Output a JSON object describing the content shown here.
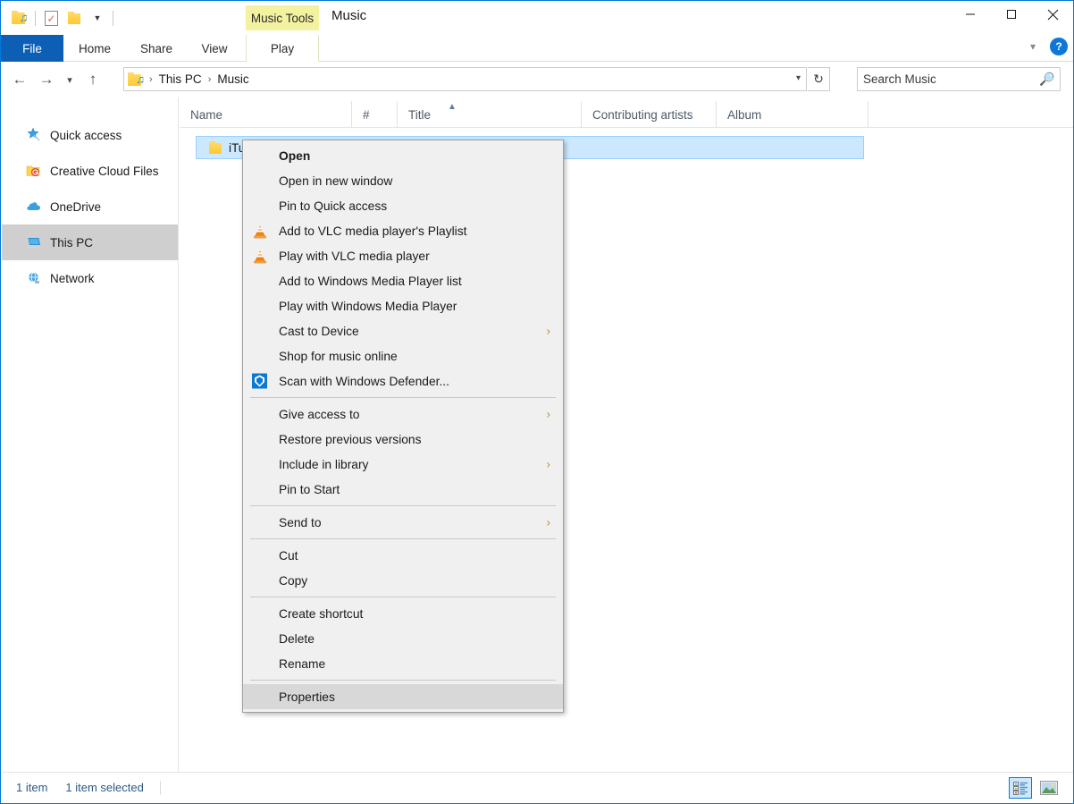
{
  "window": {
    "title": "Music",
    "contextual_tab_group": "Music Tools",
    "controls": {
      "minimize": "Minimize",
      "maximize": "Maximize",
      "close": "Close"
    }
  },
  "quick_access_toolbar": {
    "items": [
      {
        "name": "music-folder-icon",
        "label": "Music"
      },
      {
        "name": "properties-icon",
        "label": "Properties"
      },
      {
        "name": "new-folder-icon",
        "label": "New folder"
      }
    ],
    "customize_label": "Customize Quick Access Toolbar"
  },
  "ribbon": {
    "tabs": [
      {
        "label": "File",
        "active": false,
        "style": "file"
      },
      {
        "label": "Home",
        "active": false
      },
      {
        "label": "Share",
        "active": false
      },
      {
        "label": "View",
        "active": false
      },
      {
        "label": "Play",
        "active": true,
        "group": "Music Tools"
      }
    ],
    "expand_label": "Expand the Ribbon",
    "help_label": "?"
  },
  "navigation": {
    "back": "Back",
    "forward": "Forward",
    "recent": "Recent locations",
    "up": "Up",
    "breadcrumbs": [
      "This PC",
      "Music"
    ],
    "breadcrumb_separator": "›",
    "refresh": "Refresh"
  },
  "search": {
    "placeholder": "Search Music",
    "value": "",
    "icon": "search-icon"
  },
  "sidebar": {
    "items": [
      {
        "label": "Quick access",
        "icon": "star-pin-icon",
        "selected": false
      },
      {
        "label": "Creative Cloud Files",
        "icon": "creative-cloud-icon",
        "selected": false
      },
      {
        "label": "OneDrive",
        "icon": "cloud-icon",
        "selected": false
      },
      {
        "label": "This PC",
        "icon": "computer-icon",
        "selected": true
      },
      {
        "label": "Network",
        "icon": "network-icon",
        "selected": false
      }
    ]
  },
  "columns": [
    {
      "label": "Name",
      "sorted": true,
      "sort_direction": "ascending"
    },
    {
      "label": "#",
      "sorted": false
    },
    {
      "label": "Title",
      "sorted": false
    },
    {
      "label": "Contributing artists",
      "sorted": false
    },
    {
      "label": "Album",
      "sorted": false
    }
  ],
  "files": [
    {
      "name": "iTu",
      "icon": "folder-icon",
      "selected": true,
      "number": "",
      "title": "",
      "artists": "",
      "album": ""
    }
  ],
  "context_menu": {
    "groups": [
      {
        "items": [
          {
            "label": "Open",
            "bold": true,
            "icon": null,
            "submenu": false,
            "highlighted": false
          },
          {
            "label": "Open in new window",
            "bold": false,
            "icon": null,
            "submenu": false,
            "highlighted": false
          },
          {
            "label": "Pin to Quick access",
            "bold": false,
            "icon": null,
            "submenu": false,
            "highlighted": false
          },
          {
            "label": "Add to VLC media player's Playlist",
            "bold": false,
            "icon": "vlc-cone-icon",
            "submenu": false,
            "highlighted": false
          },
          {
            "label": "Play with VLC media player",
            "bold": false,
            "icon": "vlc-cone-icon",
            "submenu": false,
            "highlighted": false
          },
          {
            "label": "Add to Windows Media Player list",
            "bold": false,
            "icon": null,
            "submenu": false,
            "highlighted": false
          },
          {
            "label": "Play with Windows Media Player",
            "bold": false,
            "icon": null,
            "submenu": false,
            "highlighted": false
          },
          {
            "label": "Cast to Device",
            "bold": false,
            "icon": null,
            "submenu": true,
            "highlighted": false
          },
          {
            "label": "Shop for music online",
            "bold": false,
            "icon": null,
            "submenu": false,
            "highlighted": false
          },
          {
            "label": "Scan with Windows Defender...",
            "bold": false,
            "icon": "windows-defender-icon",
            "submenu": false,
            "highlighted": false
          }
        ]
      },
      {
        "items": [
          {
            "label": "Give access to",
            "bold": false,
            "icon": null,
            "submenu": true,
            "highlighted": false
          },
          {
            "label": "Restore previous versions",
            "bold": false,
            "icon": null,
            "submenu": false,
            "highlighted": false
          },
          {
            "label": "Include in library",
            "bold": false,
            "icon": null,
            "submenu": true,
            "highlighted": false
          },
          {
            "label": "Pin to Start",
            "bold": false,
            "icon": null,
            "submenu": false,
            "highlighted": false
          }
        ]
      },
      {
        "items": [
          {
            "label": "Send to",
            "bold": false,
            "icon": null,
            "submenu": true,
            "highlighted": false
          }
        ]
      },
      {
        "items": [
          {
            "label": "Cut",
            "bold": false,
            "icon": null,
            "submenu": false,
            "highlighted": false
          },
          {
            "label": "Copy",
            "bold": false,
            "icon": null,
            "submenu": false,
            "highlighted": false
          }
        ]
      },
      {
        "items": [
          {
            "label": "Create shortcut",
            "bold": false,
            "icon": null,
            "submenu": false,
            "highlighted": false
          },
          {
            "label": "Delete",
            "bold": false,
            "icon": null,
            "submenu": false,
            "highlighted": false
          },
          {
            "label": "Rename",
            "bold": false,
            "icon": null,
            "submenu": false,
            "highlighted": false
          }
        ]
      },
      {
        "items": [
          {
            "label": "Properties",
            "bold": false,
            "icon": null,
            "submenu": false,
            "highlighted": true
          }
        ]
      }
    ],
    "submenu_arrow": "›"
  },
  "status_bar": {
    "item_count": "1 item",
    "selection": "1 item selected",
    "views": [
      {
        "name": "details-view-button",
        "label": "Details",
        "active": true
      },
      {
        "name": "large-icons-view-button",
        "label": "Large icons",
        "active": false
      }
    ]
  },
  "colors": {
    "accent": "#0078d7",
    "file_tab": "#0c5fb5",
    "contextual_tab": "#f2f2a0",
    "selection": "#cce8ff",
    "menu_bg": "#f0f0f0",
    "menu_highlight": "#d8d8d8",
    "sidebar_selected": "#cfcfcf",
    "status_text": "#2a5a8a"
  }
}
